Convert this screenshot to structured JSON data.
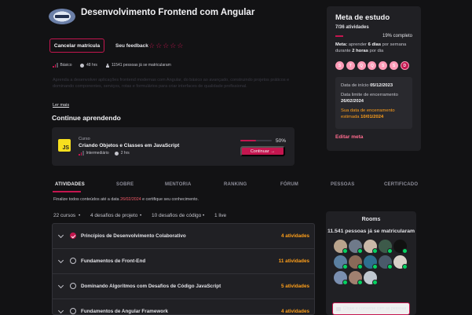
{
  "header": {
    "title": "Desenvolvimento Frontend com Angular",
    "cancel_label": "Cancelar matrícula",
    "feedback_label": "Seu feedback",
    "rating": 0,
    "stars": [
      "☆",
      "☆",
      "☆",
      "☆",
      "☆"
    ]
  },
  "meta": {
    "level": "Básico",
    "hours": "48 hrs",
    "enrolled": "11541 pessoas já se matricularam"
  },
  "description": "Aprenda a desenvolver aplicações frontend modernas com Angular, do básico ao avançado, construindo projetos práticos e dominando componentes, serviços, rotas e formulários para criar interfaces de qualidade profissional.",
  "ler_mais": "Ler mais",
  "continue": {
    "section_title": "Continue aprendendo",
    "kind": "Curso",
    "name": "Criando Objetos e Classes em JavaScript",
    "level": "Intermediário",
    "hours": "2 hrs",
    "progress": 0.5,
    "progress_text": "50%",
    "button_label": "Continuar",
    "js_label": "JS"
  },
  "goal": {
    "title": "Meta de estudo",
    "count": "7/36 atividades",
    "progress": 0.19,
    "percent_text": "19% completo",
    "goal_prefix": "Meta:",
    "goal_text_1": "aprender",
    "goal_days": "6 dias",
    "goal_text_2": "por semana durante",
    "goal_hours": "2 horas",
    "goal_text_3": "por dia",
    "days": [
      "S",
      "T",
      "Q",
      "Q",
      "S",
      "S",
      "D"
    ],
    "start_label": "Data de início",
    "start_date": "05/12/2023",
    "limit_label": "Data limite de encerramento",
    "limit_date": "26/02/2024",
    "estimate_label": "Sua data de encerramento estimada",
    "estimate_date": "10/01/2024",
    "edit_label": "Editar meta"
  },
  "tabs": [
    "ATIVIDADES",
    "SOBRE",
    "MENTORIA",
    "RANKING",
    "FÓRUM",
    "PESSOAS",
    "CERTIFICADO"
  ],
  "deadline": {
    "prefix": "Finalize todos conteúdos até a data",
    "date": "26/02/2024",
    "suffix": "e certifique seu conhecimento."
  },
  "stats": [
    "22 cursos",
    "4 desafios de projeto",
    "10 desafios de código",
    "1 live"
  ],
  "modules": [
    {
      "name": "Princípios de Desenvolvimento Colaborativo",
      "count": "4 atividades",
      "done": true
    },
    {
      "name": "Fundamentos de Front-End",
      "count": "11 atividades",
      "done": false
    },
    {
      "name": "Dominando Algoritmos com Desafios de Código JavaScript",
      "count": "5 atividades",
      "done": false
    },
    {
      "name": "Fundamentos de Angular Framework",
      "count": "4 atividades",
      "done": false
    }
  ],
  "rooms": {
    "title": "Rooms",
    "enrolled": "11.541 pessoas já se matricularam",
    "chat_label": "Clique e converse com as pessoas"
  },
  "colors": {
    "accent": "#c4164f",
    "background": "#121214",
    "card": "#202024",
    "warning": "#ff9f1a",
    "online": "#04d361"
  }
}
